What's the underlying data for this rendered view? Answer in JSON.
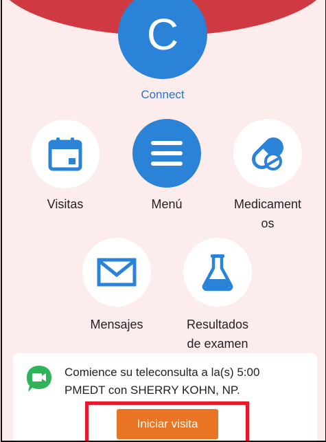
{
  "app": {
    "avatar_letter": "C",
    "name": "Connect"
  },
  "menu": {
    "items": [
      {
        "label": "Visitas",
        "icon": "calendar-icon"
      },
      {
        "label": "Menú",
        "icon": "hamburger-menu-icon"
      },
      {
        "label": "Medicamentos",
        "label_line1": "Medicament",
        "label_line2": "os",
        "icon": "pill-capsule-icon"
      },
      {
        "label": "Mensajes",
        "icon": "envelope-icon"
      },
      {
        "label": "Resultados de examen",
        "label_line1": "Resultados",
        "label_line2": "de examen",
        "icon": "flask-icon"
      }
    ]
  },
  "notice": {
    "icon": "video-chat-icon",
    "text": "Comience su teleconsulta a la(s) 5:00 PMEDT con SHERRY KOHN, NP.",
    "text_line1": "Comience su teleconsulta a la(s) 5:00",
    "text_line2": "PMEDT con SHERRY KOHN, NP.",
    "button_label": "Iniciar visita"
  },
  "colors": {
    "background": "#fcecec",
    "header_arc": "#cf3a42",
    "brand_blue": "#2b83d8",
    "button_orange": "#e87424",
    "chat_green": "#2fb35a",
    "highlight_red": "#e8182a"
  }
}
